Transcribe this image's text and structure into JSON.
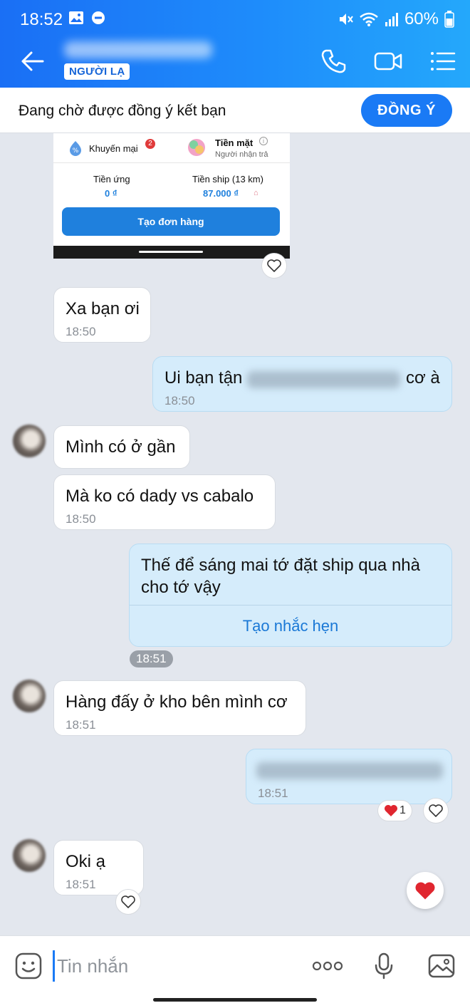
{
  "colors": {
    "brand": "#1a7af5",
    "out_bubble": "#d5ecfb",
    "in_bubble": "#ffffff",
    "chat_bg": "#e3e7ee"
  },
  "status": {
    "time": "18:52",
    "battery": "60%"
  },
  "header": {
    "badge": "NGƯỜI LẠ",
    "icons": [
      "back-arrow-icon",
      "phone-icon",
      "video-icon",
      "menu-icon"
    ]
  },
  "request": {
    "text": "Đang chờ được đồng ý kết bạn",
    "button": "ĐỒNG Ý"
  },
  "card": {
    "promo_label": "Khuyến mại",
    "promo_count": "2",
    "pay_label": "Tiền mặt",
    "pay_sub": "Người nhận trả",
    "advance_label": "Tiền ứng",
    "advance_value": "0 ₫",
    "ship_label": "Tiền ship (13 km)",
    "ship_value": "87.000 ₫",
    "order_button": "Tạo đơn hàng"
  },
  "messages": {
    "m1": {
      "text": "Xa bạn ơi",
      "time": "18:50"
    },
    "m2": {
      "text_before": "Ui bạn tận",
      "text_after": "cơ à",
      "time": "18:50"
    },
    "m3": {
      "text": "Mình có ở gần"
    },
    "m4": {
      "text": "Mà ko có dady vs cabalo",
      "time": "18:50"
    },
    "m5": {
      "line1": "Thế để sáng mai tớ đặt ship qua nhà",
      "line2": "cho tớ vậy",
      "action": "Tạo nhắc hẹn"
    },
    "pill_time": "18:51",
    "m6": {
      "text": "Hàng đấy ở kho bên mình cơ",
      "time": "18:51"
    },
    "m7": {
      "time": "18:51",
      "reaction_count": "1"
    },
    "m8": {
      "text": "Oki ạ",
      "time": "18:51"
    }
  },
  "input": {
    "placeholder": "Tin nhắn"
  }
}
